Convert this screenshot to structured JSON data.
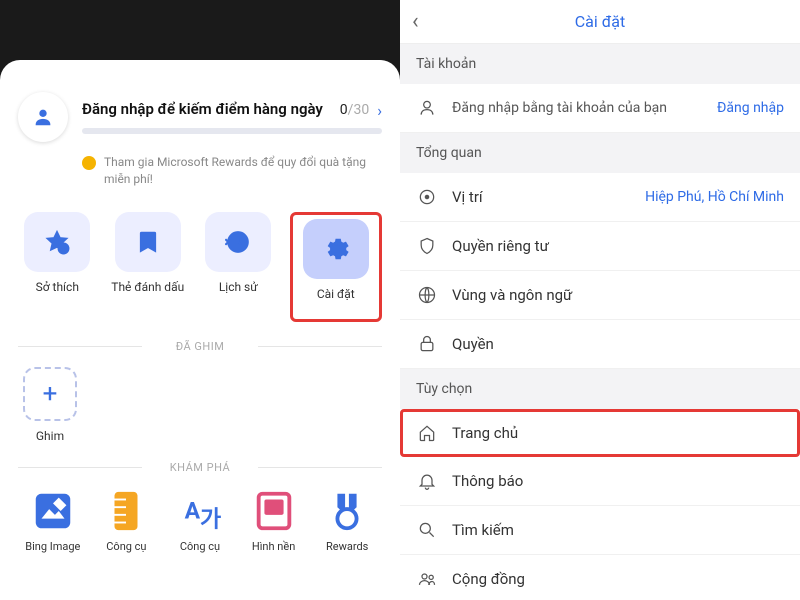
{
  "left": {
    "signin_title": "Đăng nhập để kiếm điểm hàng ngày",
    "counter_current": "0",
    "counter_max": "/30",
    "rewards_text": "Tham gia Microsoft Rewards để quy đổi quà tặng miễn phí!",
    "tiles": [
      {
        "name": "interests-tile",
        "icon": "star",
        "label": "Sở thích"
      },
      {
        "name": "bookmarks-tile",
        "icon": "bookmark",
        "label": "Thẻ đánh dấu"
      },
      {
        "name": "history-tile",
        "icon": "history",
        "label": "Lịch sử"
      },
      {
        "name": "settings-tile",
        "icon": "gear",
        "label": "Cài đặt",
        "highlight": true
      }
    ],
    "pinned_label": "ĐÃ GHIM",
    "pin_add_label": "Ghim",
    "explore_label": "KHÁM PHÁ",
    "explore": [
      {
        "name": "bing-image-tile",
        "label": "Bing Image",
        "color": "#3a6fe0"
      },
      {
        "name": "tools-tile",
        "label": "Công cụ",
        "color": "#f5a623"
      },
      {
        "name": "translate-tile",
        "label": "Công cụ",
        "color": "#3a6fe0"
      },
      {
        "name": "wallpaper-tile",
        "label": "Hình nền",
        "color": "#e04f7a"
      },
      {
        "name": "rewards-tile",
        "label": "Rewards",
        "color": "#3a6fe0"
      }
    ]
  },
  "right": {
    "header_title": "Cài đặt",
    "sections": {
      "account": "Tài khoản",
      "overview": "Tổng quan",
      "options": "Tùy chọn"
    },
    "signin_sub": "Đăng nhập bằng tài khoản của bạn",
    "signin_action": "Đăng nhập",
    "rows": {
      "location_label": "Vị trí",
      "location_value": "Hiệp Phú, Hồ Chí Minh",
      "privacy": "Quyền riêng tư",
      "region": "Vùng và ngôn ngữ",
      "permissions": "Quyền",
      "home": "Trang chủ",
      "notifications": "Thông báo",
      "search": "Tìm kiếm",
      "community": "Cộng đồng"
    }
  }
}
